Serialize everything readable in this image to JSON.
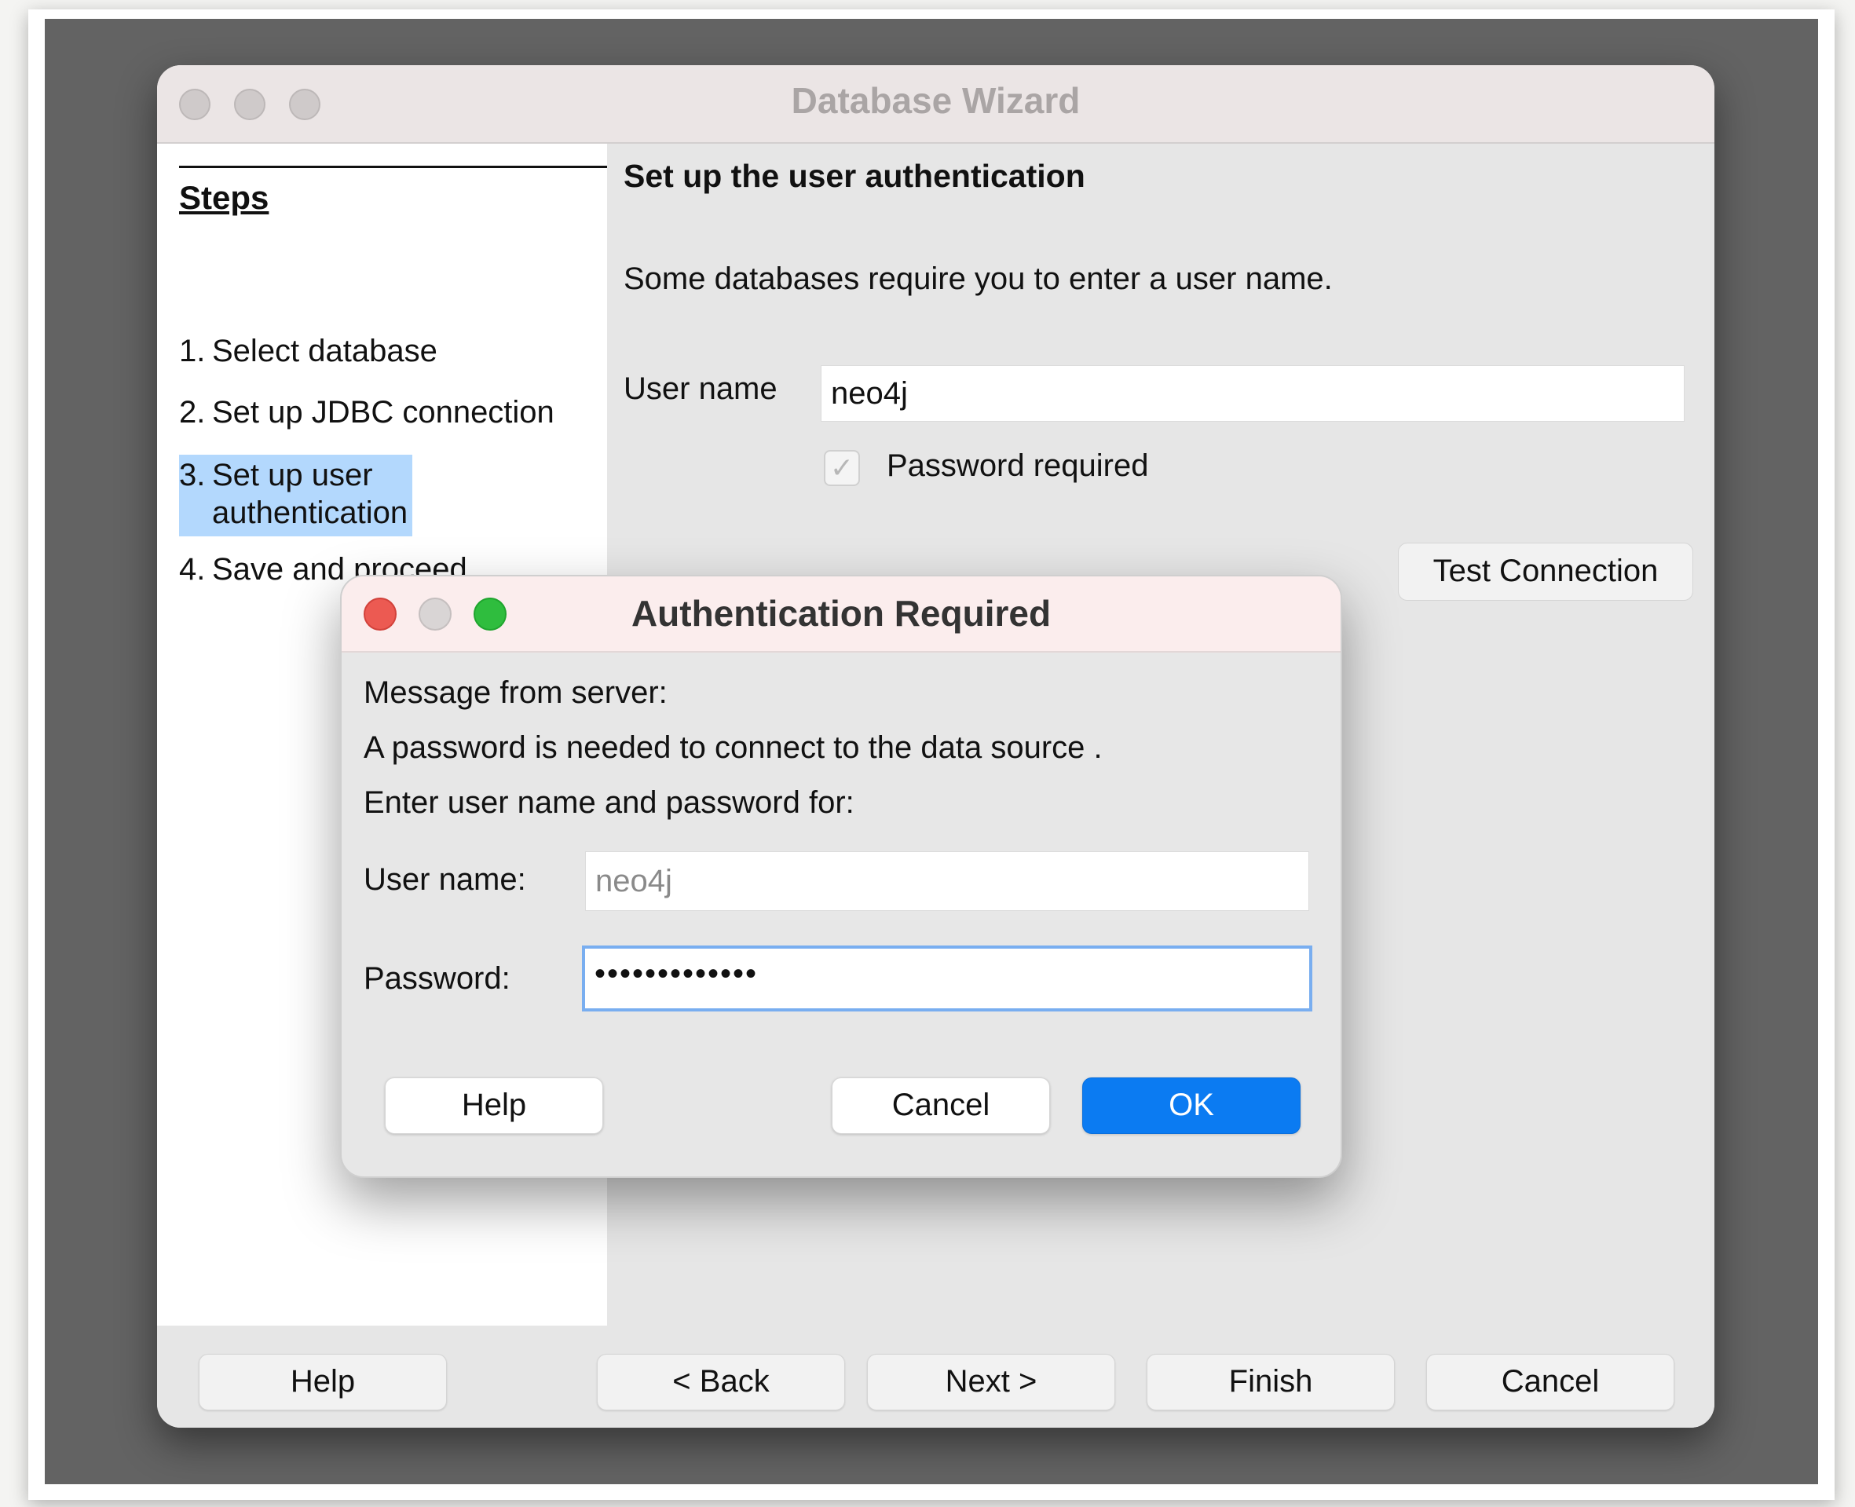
{
  "wizard": {
    "title": "Database Wizard",
    "steps_heading": "Steps",
    "steps": [
      {
        "num": "1.",
        "label": "Select database"
      },
      {
        "num": "2.",
        "label": "Set up JDBC connection"
      },
      {
        "num": "3.",
        "label_line1": "Set up user",
        "label_line2": "authentication"
      },
      {
        "num": "4.",
        "label": "Save and proceed"
      }
    ],
    "active_step": 3,
    "content": {
      "heading": "Set up the user authentication",
      "description": "Some databases require you to enter a user name.",
      "user_name_label": "User name",
      "user_name_value": "neo4j",
      "password_required_label": "Password required",
      "password_required_checked": true,
      "test_connection_label": "Test Connection"
    },
    "footer": {
      "help": "Help",
      "back": "< Back",
      "next": "Next >",
      "finish": "Finish",
      "cancel": "Cancel"
    }
  },
  "dialog": {
    "title": "Authentication Required",
    "message_header": "Message from server:",
    "message_body": "A password is needed to connect to the data source .",
    "prompt": "Enter user name and password for:",
    "user_name_label": "User name:",
    "user_name_value": "neo4j",
    "password_label": "Password:",
    "password_mask": "•••••••••••••",
    "help": "Help",
    "cancel": "Cancel",
    "ok": "OK"
  },
  "colors": {
    "accent": "#0b7bf2",
    "step_highlight": "#b3d8fd",
    "close": "#ec5a52",
    "maximize": "#2fbd3e"
  }
}
